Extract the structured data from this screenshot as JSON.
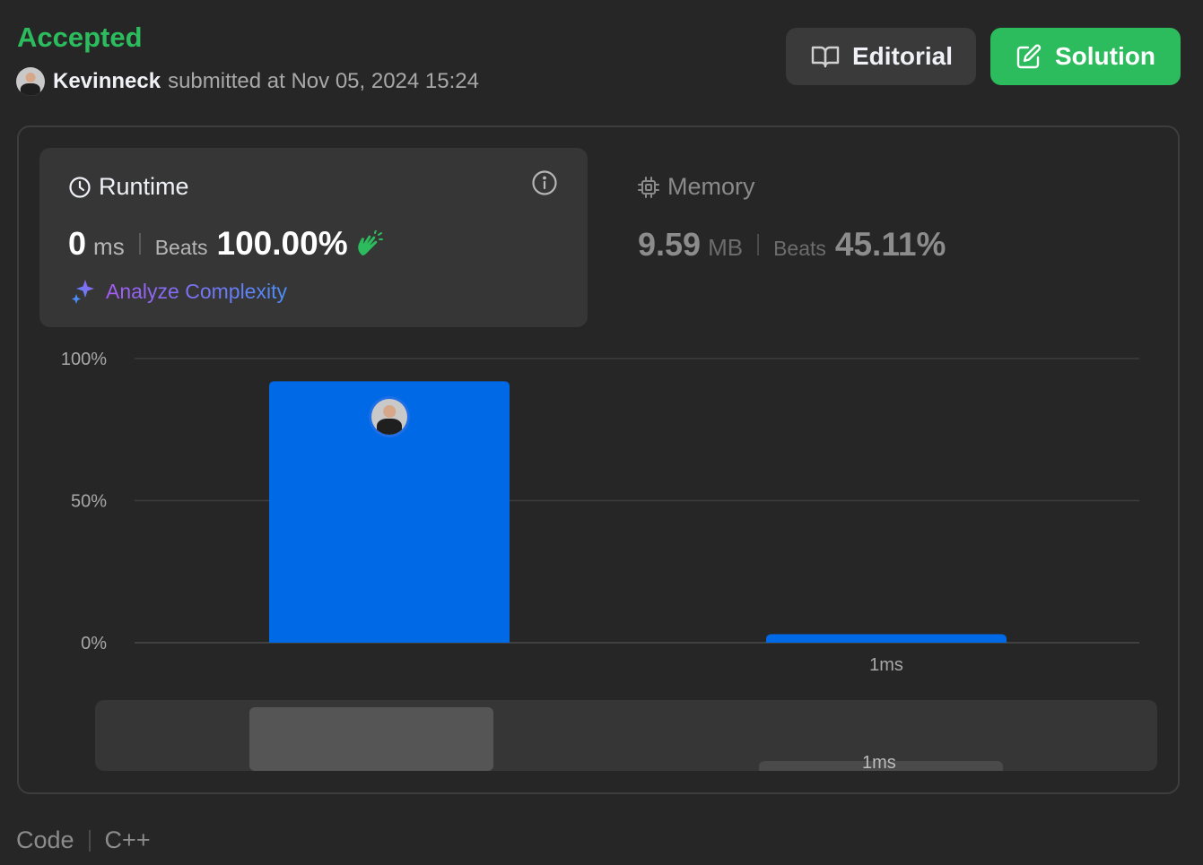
{
  "status": {
    "label": "Accepted",
    "color": "#2cbb5d"
  },
  "submission": {
    "username": "Kevinneck",
    "submitted_text": "submitted at Nov 05, 2024 15:24"
  },
  "buttons": {
    "editorial": "Editorial",
    "solution": "Solution"
  },
  "runtime": {
    "title": "Runtime",
    "value": "0",
    "unit": "ms",
    "beats_label": "Beats",
    "beats_pct": "100.00%",
    "analyze": "Analyze Complexity"
  },
  "memory": {
    "title": "Memory",
    "value": "9.59",
    "unit": "MB",
    "beats_label": "Beats",
    "beats_pct": "45.11%"
  },
  "chart_data": {
    "type": "bar",
    "categories": [
      "",
      "1ms"
    ],
    "values": [
      92,
      3
    ],
    "ylim": [
      0,
      100
    ],
    "yticks": [
      "0%",
      "50%",
      "100%"
    ],
    "grid": true,
    "bar_color": "#0069e6"
  },
  "navigator": {
    "label": "1ms"
  },
  "footer": {
    "code_label": "Code",
    "language": "C++"
  }
}
